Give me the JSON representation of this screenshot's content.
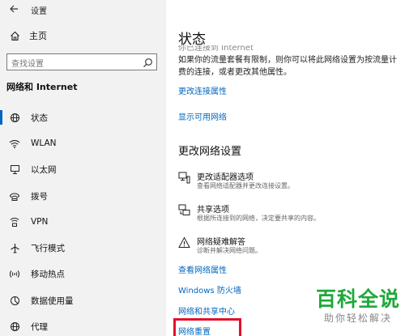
{
  "window": {
    "title": "设置"
  },
  "sidebar": {
    "home_label": "主页",
    "search_placeholder": "查找设置",
    "section_title": "网络和 Internet",
    "items": [
      {
        "label": "状态",
        "icon": "globe-icon",
        "active": true
      },
      {
        "label": "WLAN",
        "icon": "wifi-icon"
      },
      {
        "label": "以太网",
        "icon": "ethernet-icon"
      },
      {
        "label": "拨号",
        "icon": "dialup-icon"
      },
      {
        "label": "VPN",
        "icon": "vpn-icon"
      },
      {
        "label": "飞行模式",
        "icon": "airplane-icon"
      },
      {
        "label": "移动热点",
        "icon": "hotspot-icon"
      },
      {
        "label": "数据使用量",
        "icon": "data-usage-icon"
      },
      {
        "label": "代理",
        "icon": "globe-icon"
      }
    ]
  },
  "main": {
    "title": "状态",
    "cut_text": "你已连接到 Internet",
    "description": "如果你的流量套餐有限制，则你可以将此网络设置为按流量计费的连接，或者更改其他属性。",
    "change_connection_props": "更改连接属性",
    "show_available_networks": "显示可用网络",
    "change_settings_heading": "更改网络设置",
    "options": [
      {
        "title": "更改适配器选项",
        "desc": "查看网络适配器并更改连接设置。",
        "icon": "adapter-icon"
      },
      {
        "title": "共享选项",
        "desc": "根据所连接到的网络，决定要共享的内容。",
        "icon": "share-icon"
      },
      {
        "title": "网络疑难解答",
        "desc": "诊断并解决网络问题。",
        "icon": "warning-icon"
      }
    ],
    "links": {
      "view_props": "查看网络属性",
      "firewall": "Windows 防火墙",
      "sharing_center": "网络和共享中心",
      "reset": "网络重置"
    }
  },
  "watermark": {
    "main": "百科全说",
    "sub": "助你轻松解决"
  },
  "colors": {
    "accent": "#0067c0",
    "highlight": "#e0112b",
    "watermark": "#1fa83a"
  }
}
